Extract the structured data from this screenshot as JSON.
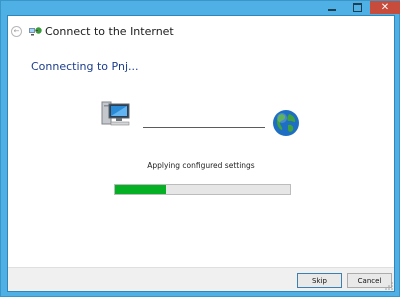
{
  "window": {
    "title": "Connect to the Internet",
    "controls": {
      "minimize": "—",
      "maximize": "□",
      "close": "✕"
    }
  },
  "nav": {
    "back_icon": "back-arrow-icon",
    "back_glyph": "←"
  },
  "main": {
    "heading": "Connecting to Pnj...",
    "status": "Applying configured settings",
    "progress_fraction": 0.29
  },
  "buttons": {
    "skip": "Skip",
    "cancel": "Cancel"
  },
  "colors": {
    "frame": "#4fb0e6",
    "close_button": "#c74c3c",
    "heading_text": "#1c3d8f",
    "progress_fill": "#06b025"
  },
  "icons": [
    "network-icon",
    "computer-icon",
    "globe-icon",
    "resize-grip-icon"
  ]
}
